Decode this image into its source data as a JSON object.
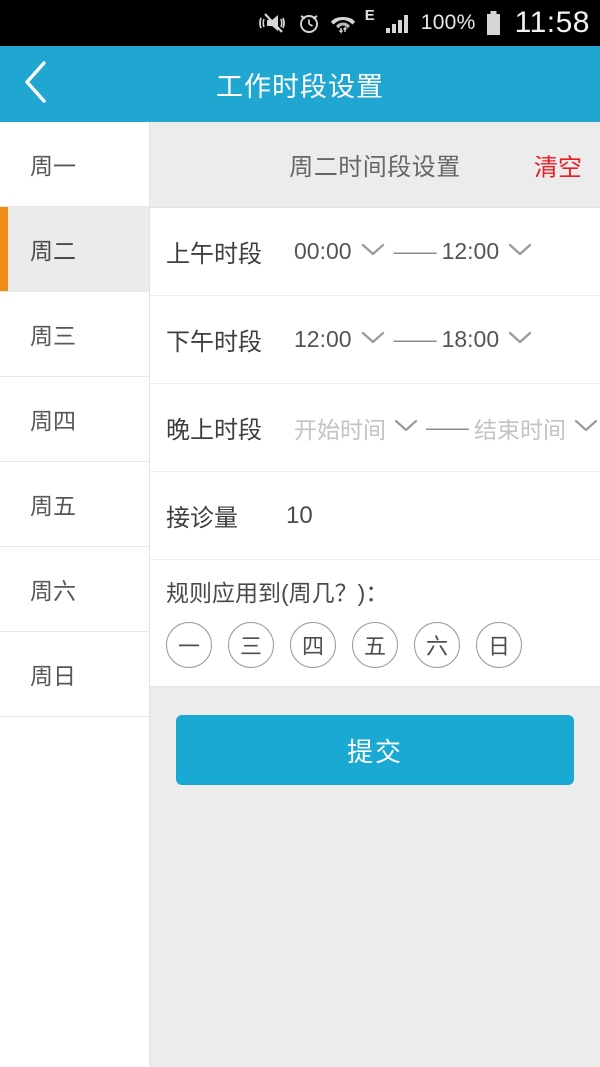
{
  "status_bar": {
    "icons": [
      "vibrate-mute-icon",
      "alarm-clock-icon",
      "wifi-icon",
      "signal-bars-icon"
    ],
    "network_type": "E",
    "battery_percent": "100%",
    "clock": "11:58"
  },
  "header": {
    "back_icon": "chevron-left-icon",
    "title": "工作时段设置",
    "background_color": "#1fa7d2"
  },
  "sidebar": {
    "items": [
      {
        "label": "周一",
        "selected": false
      },
      {
        "label": "周二",
        "selected": true
      },
      {
        "label": "周三",
        "selected": false
      },
      {
        "label": "周四",
        "selected": false
      },
      {
        "label": "周五",
        "selected": false
      },
      {
        "label": "周六",
        "selected": false
      },
      {
        "label": "周日",
        "selected": false
      }
    ],
    "selected_indicator_color": "#ef8b17"
  },
  "panel": {
    "title": "周二时间段设置",
    "clear_label": "清空",
    "clear_color": "#ec1c24",
    "rows": [
      {
        "label": "上午时段",
        "start_value": "00:00",
        "start_placeholder": "开始时间",
        "end_value": "12:00",
        "end_placeholder": "结束时间",
        "separator": "——",
        "is_placeholder": false
      },
      {
        "label": "下午时段",
        "start_value": "12:00",
        "start_placeholder": "开始时间",
        "end_value": "18:00",
        "end_placeholder": "结束时间",
        "separator": "——",
        "is_placeholder": false
      },
      {
        "label": "晚上时段",
        "start_value": "开始时间",
        "start_placeholder": "开始时间",
        "end_value": "结束时间",
        "end_placeholder": "结束时间",
        "separator": "——",
        "is_placeholder": true
      }
    ],
    "capacity": {
      "label": "接诊量",
      "value": "10"
    },
    "apply_rule": {
      "label": "规则应用到(周几？)：",
      "chips": [
        {
          "label": "一",
          "selected": false
        },
        {
          "label": "三",
          "selected": false
        },
        {
          "label": "四",
          "selected": false
        },
        {
          "label": "五",
          "selected": false
        },
        {
          "label": "六",
          "selected": false
        },
        {
          "label": "日",
          "selected": false
        }
      ]
    },
    "submit_label": "提交",
    "submit_color": "#1aa9d3"
  }
}
